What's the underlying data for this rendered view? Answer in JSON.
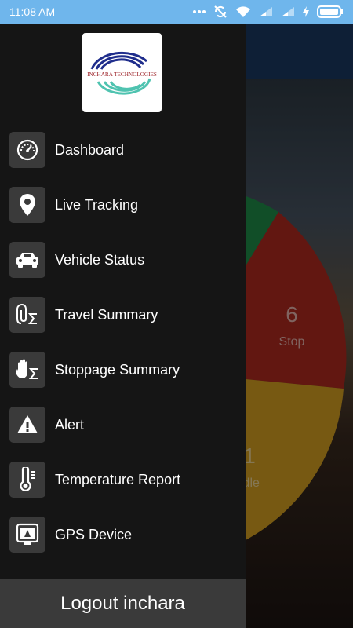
{
  "status_bar": {
    "time": "11:08 AM",
    "icons": [
      "more-dots-icon",
      "sync-off-icon",
      "wifi-icon",
      "signal-icon",
      "signal-icon",
      "charging-icon",
      "battery-icon"
    ]
  },
  "drawer": {
    "logo_text": "INCHARA TECHNOLOGIES",
    "items": [
      {
        "label": "Dashboard",
        "icon": "speedometer-icon"
      },
      {
        "label": "Live Tracking",
        "icon": "map-pin-icon"
      },
      {
        "label": "Vehicle Status",
        "icon": "car-icon"
      },
      {
        "label": "Travel Summary",
        "icon": "paperclip-sigma-icon"
      },
      {
        "label": "Stoppage Summary",
        "icon": "hand-sigma-icon"
      },
      {
        "label": "Alert",
        "icon": "warning-icon"
      },
      {
        "label": "Temperature Report",
        "icon": "thermometer-icon"
      },
      {
        "label": "GPS Device",
        "icon": "gps-device-icon"
      }
    ],
    "logout_label": "Logout inchara"
  },
  "background_chart": {
    "stop_value": "6",
    "stop_label": "Stop",
    "idle_value": "1",
    "idle_label": "Idle",
    "colors": {
      "stop": "#b22a20",
      "idle": "#d9a322",
      "running": "#1f8f4a"
    }
  }
}
